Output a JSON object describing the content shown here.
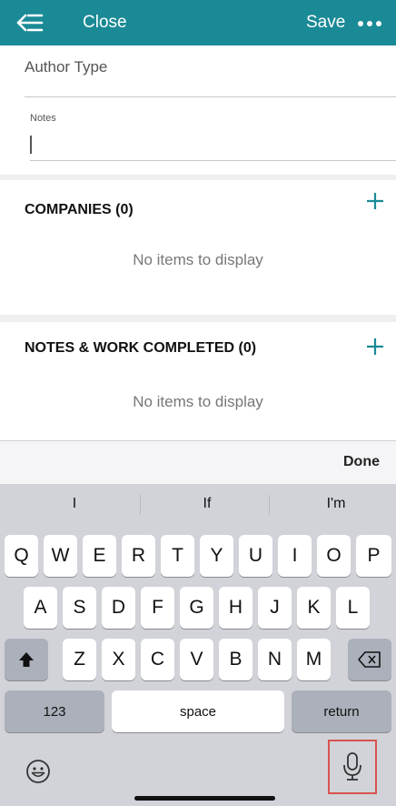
{
  "header": {
    "close_label": "Close",
    "save_label": "Save",
    "back_icon": "back-menu-icon",
    "more_icon": "more-horizontal-icon"
  },
  "form": {
    "author_type_label": "Author Type",
    "notes_label": "Notes",
    "notes_value": ""
  },
  "sections": {
    "companies": {
      "title": "COMPANIES (0)",
      "empty_text": "No items to display"
    },
    "notes_work": {
      "title": "NOTES & WORK COMPLETED (0)",
      "empty_text": "No items to display"
    }
  },
  "keyboard": {
    "done_label": "Done",
    "suggestions": [
      "I",
      "If",
      "I'm"
    ],
    "row1": [
      "Q",
      "W",
      "E",
      "R",
      "T",
      "Y",
      "U",
      "I",
      "O",
      "P"
    ],
    "row2": [
      "A",
      "S",
      "D",
      "F",
      "G",
      "H",
      "J",
      "K",
      "L"
    ],
    "row3": [
      "Z",
      "X",
      "C",
      "V",
      "B",
      "N",
      "M"
    ],
    "numbers_label": "123",
    "space_label": "space",
    "return_label": "return"
  },
  "colors": {
    "header_bg": "#1a8a96",
    "accent": "#1a8a96",
    "highlight": "#d9534f"
  }
}
